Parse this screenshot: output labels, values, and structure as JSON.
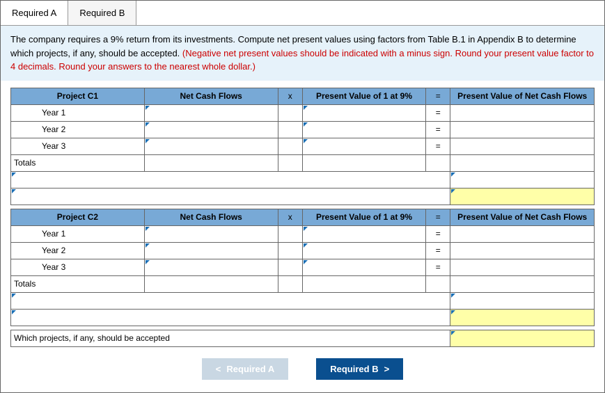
{
  "tabs": {
    "a": "Required A",
    "b": "Required B"
  },
  "instructions": {
    "black": "The company requires a 9% return from its investments. Compute net present values using factors from Table B.1 in Appendix B to determine which projects, if any, should be accepted. ",
    "red": "(Negative net present values should be indicated with a minus sign. Round your present value factor to 4 decimals. Round your answers to the nearest whole dollar.)"
  },
  "headers": {
    "ncf": "Net Cash Flows",
    "x": "x",
    "pvf": "Present Value of 1 at 9%",
    "eq": "=",
    "pvncf": "Present Value of Net Cash Flows"
  },
  "projects": {
    "c1": {
      "name": "Project C1",
      "years": [
        "Year 1",
        "Year 2",
        "Year 3"
      ],
      "totals": "Totals"
    },
    "c2": {
      "name": "Project C2",
      "years": [
        "Year 1",
        "Year 2",
        "Year 3"
      ],
      "totals": "Totals"
    }
  },
  "question": "Which projects, if any, should be accepted",
  "nav": {
    "prev": "Required A",
    "next": "Required B"
  },
  "symbols": {
    "chevl": "<",
    "chevr": ">"
  }
}
